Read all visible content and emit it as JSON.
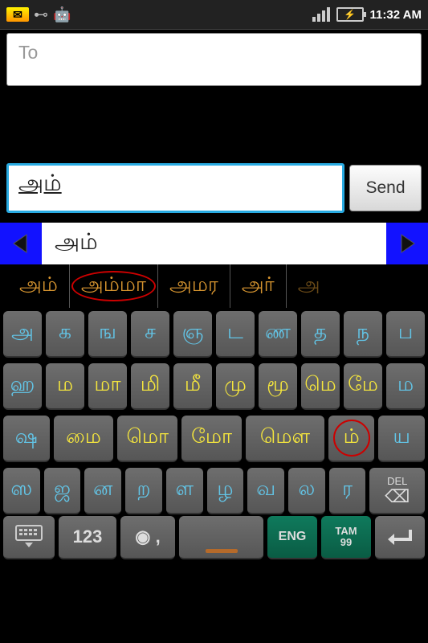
{
  "status": {
    "time": "11:32 AM"
  },
  "to": {
    "placeholder": "To"
  },
  "compose": {
    "value": "அம்",
    "send_label": "Send"
  },
  "candidate": {
    "main": "அம்"
  },
  "suggestions": [
    "அம்",
    "அம்மா",
    "அமர",
    "அர்",
    "அ"
  ],
  "keys": {
    "row1": [
      "அ",
      "க",
      "ங",
      "ச",
      "ஞ",
      "ட",
      "ண",
      "த",
      "ந",
      "ப"
    ],
    "row2": [
      "ஹ",
      "ம",
      "மா",
      "மி",
      "மீ",
      "மு",
      "மூ",
      "மெ",
      "மே",
      "ம"
    ],
    "row3": [
      "ஷ",
      "மை",
      "மொ",
      "மோ",
      "மௌ",
      "ம்",
      "ய"
    ],
    "row4": [
      "ஸ",
      "ஜ",
      "ன",
      "ற",
      "ள",
      "ழ",
      "வ",
      "ல",
      "ர"
    ],
    "del": "DEL"
  },
  "bottom": {
    "num": "123",
    "rec": "◉ ,",
    "eng": "ENG",
    "tam1": "TAM",
    "tam2": "99"
  }
}
